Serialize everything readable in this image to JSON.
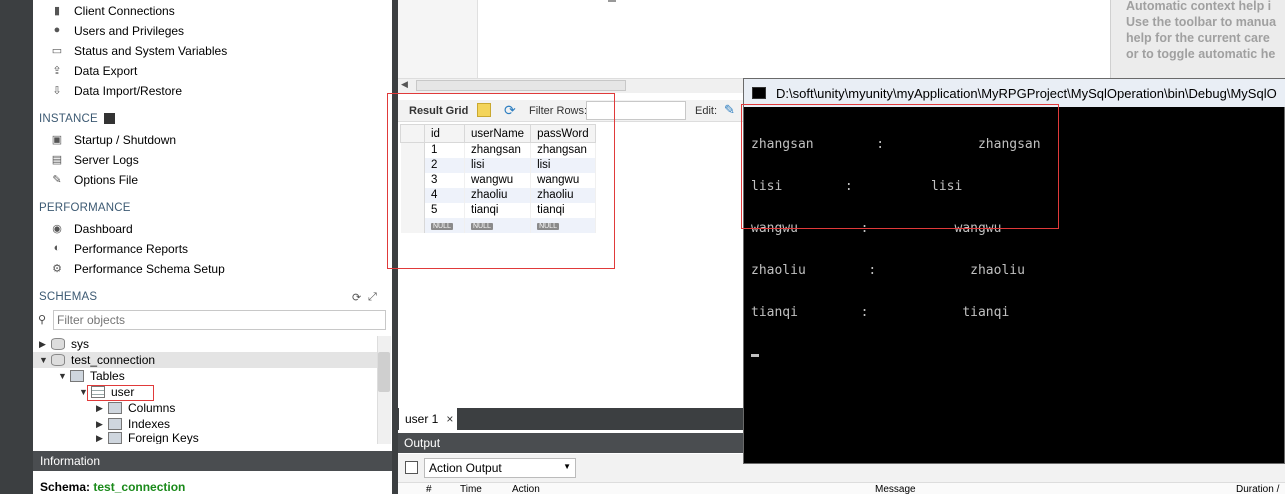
{
  "sidebar": {
    "management_items": [
      {
        "label": "Client Connections",
        "icon": "client-connections-icon"
      },
      {
        "label": "Users and Privileges",
        "icon": "users-icon"
      },
      {
        "label": "Status and System Variables",
        "icon": "status-icon"
      },
      {
        "label": "Data Export",
        "icon": "export-icon"
      },
      {
        "label": "Data Import/Restore",
        "icon": "import-icon"
      }
    ],
    "instance_header": "INSTANCE",
    "instance_items": [
      {
        "label": "Startup / Shutdown"
      },
      {
        "label": "Server Logs"
      },
      {
        "label": "Options File"
      }
    ],
    "performance_header": "PERFORMANCE",
    "performance_items": [
      {
        "label": "Dashboard"
      },
      {
        "label": "Performance Reports"
      },
      {
        "label": "Performance Schema Setup"
      }
    ],
    "schemas_header": "SCHEMAS",
    "filter_placeholder": "Filter objects",
    "tree": {
      "sys": "sys",
      "test_connection": "test_connection",
      "tables": "Tables",
      "user": "user",
      "columns": "Columns",
      "indexes": "Indexes",
      "foreign_keys": "Foreign Keys"
    },
    "info_header": "Information",
    "schema_label": "Schema:",
    "schema_value": "test_connection"
  },
  "result_toolbar": {
    "result_grid": "Result Grid",
    "filter_rows": "Filter Rows:",
    "edit": "Edit:"
  },
  "grid": {
    "columns": [
      "id",
      "userName",
      "passWord"
    ],
    "rows": [
      [
        "1",
        "zhangsan",
        "zhangsan"
      ],
      [
        "2",
        "lisi",
        "lisi"
      ],
      [
        "3",
        "wangwu",
        "wangwu"
      ],
      [
        "4",
        "zhaoliu",
        "zhaoliu"
      ],
      [
        "5",
        "tianqi",
        "tianqi"
      ]
    ],
    "null_label": "NULL"
  },
  "tabs": {
    "user_tab": "user 1",
    "close": "×"
  },
  "output": {
    "header": "Output",
    "selector": "Action Output",
    "columns": [
      "#",
      "Time",
      "Action",
      "Message",
      "Duration /"
    ]
  },
  "help": {
    "lines": [
      "Automatic context help i",
      "Use the toolbar to manua",
      "help for the current care",
      "or to toggle automatic he"
    ]
  },
  "console": {
    "title": "D:\\soft\\unity\\myunity\\myApplication\\MyRPGProject\\MySqlOperation\\bin\\Debug\\MySqlO",
    "lines": [
      "zhangsan        :            zhangsan",
      "lisi        :          lisi",
      "wangwu        :           wangwu",
      "zhaoliu        :            zhaoliu",
      "tianqi        :            tianqi"
    ]
  }
}
